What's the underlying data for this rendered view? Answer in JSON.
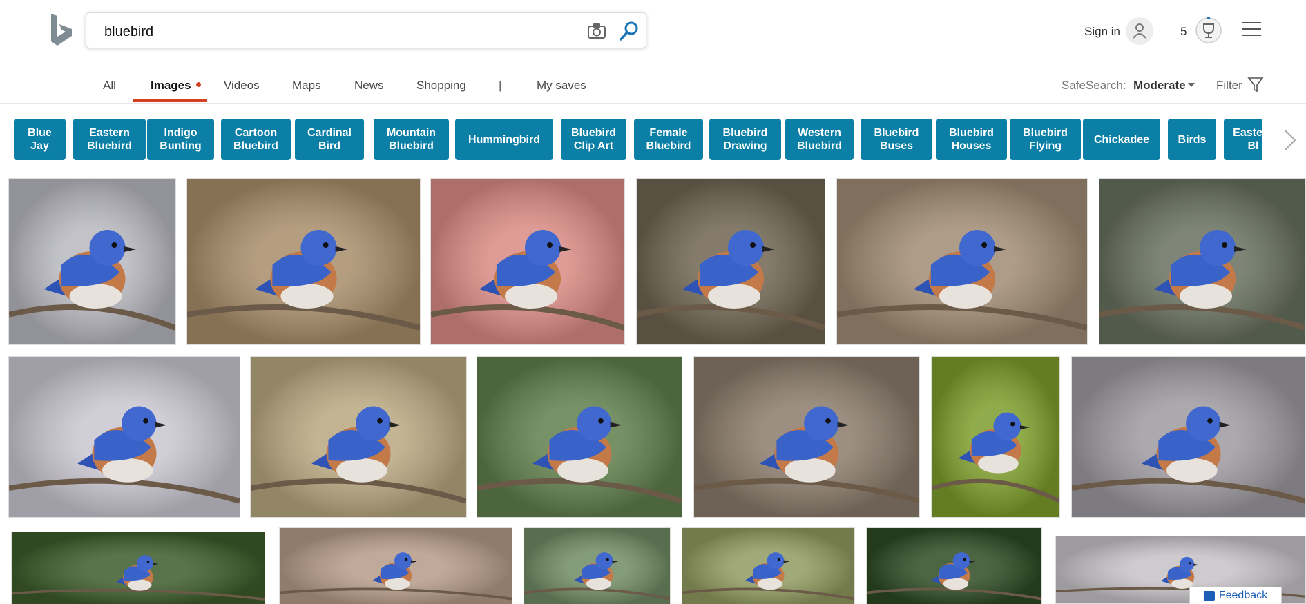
{
  "search": {
    "query": "bluebird"
  },
  "header": {
    "sign_in": "Sign in",
    "points": "5"
  },
  "tabs": [
    {
      "label": "All"
    },
    {
      "label": "Images"
    },
    {
      "label": "Videos"
    },
    {
      "label": "Maps"
    },
    {
      "label": "News"
    },
    {
      "label": "Shopping"
    },
    {
      "label": "|"
    },
    {
      "label": "My saves"
    }
  ],
  "toolbar": {
    "safesearch_label": "SafeSearch:",
    "safesearch_value": "Moderate",
    "filter_label": "Filter"
  },
  "related": [
    "Blue\nJay",
    "Eastern\nBluebird",
    "Indigo\nBunting",
    "Cartoon\nBluebird",
    "Cardinal\nBird",
    "Mountain\nBluebird",
    "Hummingbird",
    "Bluebird\nClip Art",
    "Female\nBluebird",
    "Bluebird\nDrawing",
    "Western\nBluebird",
    "Bluebird\nBuses",
    "Bluebird\nHouses",
    "Bluebird\nFlying",
    "Chickadee",
    "Birds",
    "Eastern\nBl"
  ],
  "colors": {
    "chip_bg": "#0b7fa6",
    "accent": "#d3401f",
    "link": "#1a5eb5"
  },
  "images": [
    {
      "bg": "#b7b7bf",
      "bird": "perched-branch"
    },
    {
      "bg": "#a88d6a",
      "bird": "perched-log"
    },
    {
      "bg": "#d98a84",
      "bird": "fluffed"
    },
    {
      "bg": "#6e6450",
      "bird": "perched-branch"
    },
    {
      "bg": "#a08b73",
      "bird": "perched-branch"
    },
    {
      "bg": "#67705e",
      "bird": "pair"
    },
    {
      "bg": "#c8c5cf",
      "bird": "perched-branch"
    },
    {
      "bg": "#b8a780",
      "bird": "post"
    },
    {
      "bg": "#5f7e4c",
      "bird": "mountain"
    },
    {
      "bg": "#8a7b6b",
      "bird": "perched-branch"
    },
    {
      "bg": "#7d9c2b",
      "bird": "perched-branch"
    },
    {
      "bg": "#9e9aa0",
      "bird": "fence"
    },
    {
      "bg": "#3c5b2a",
      "bird": "partial"
    },
    {
      "bg": "#b59a86",
      "bird": "partial"
    },
    {
      "bg": "#6f8a62",
      "bird": "partial"
    },
    {
      "bg": "#909a60",
      "bird": "partial"
    },
    {
      "bg": "#2d4a22",
      "bird": "partial"
    },
    {
      "bg": "#c6c2c6",
      "bird": "partial"
    }
  ],
  "feedback": "Feedback"
}
